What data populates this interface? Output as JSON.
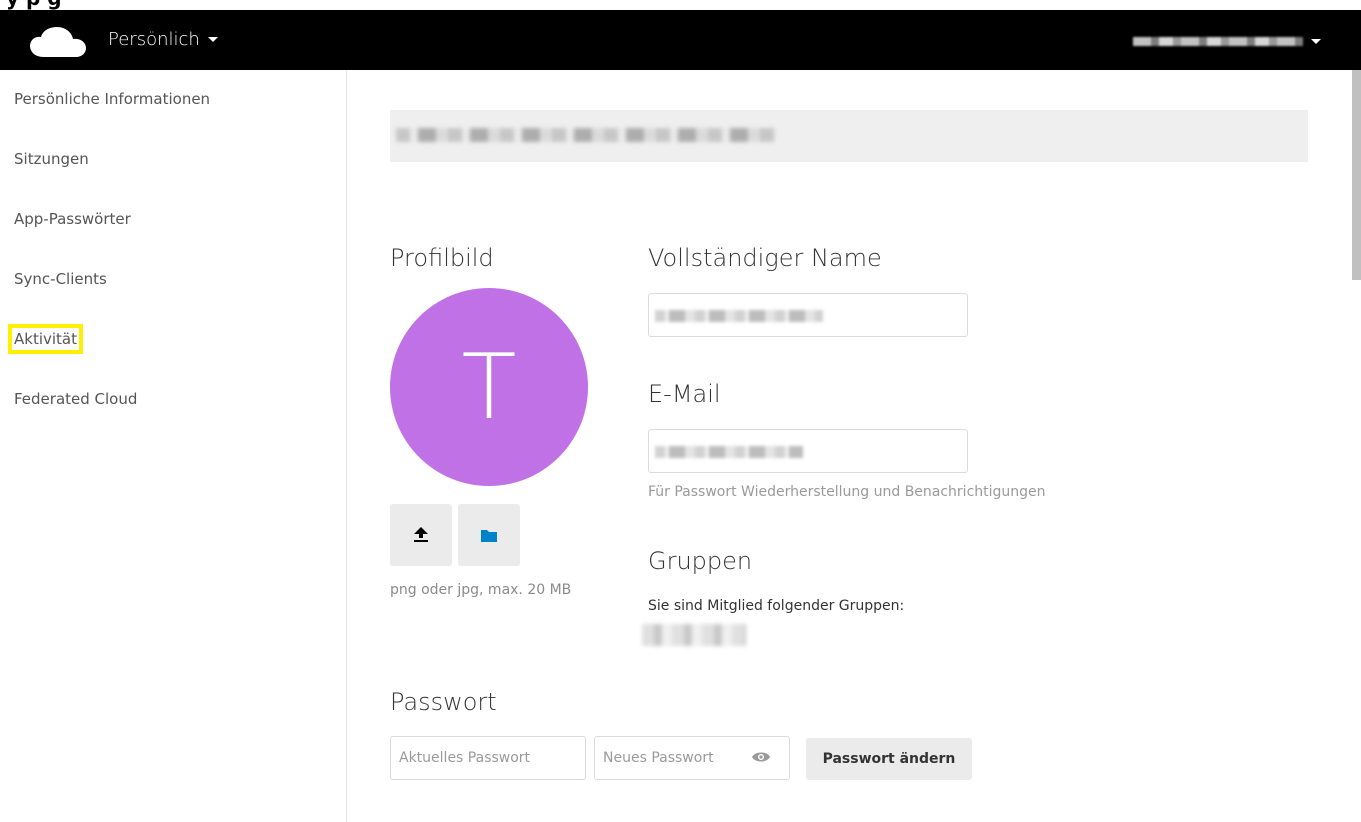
{
  "header": {
    "top_strip_text": "y        p                                          g",
    "app_menu_label": "Persönlich"
  },
  "sidebar": {
    "items": [
      {
        "label": "Persönliche Informationen"
      },
      {
        "label": "Sitzungen"
      },
      {
        "label": "App-Passwörter"
      },
      {
        "label": "Sync-Clients"
      },
      {
        "label": "Aktivität"
      },
      {
        "label": "Federated Cloud"
      }
    ]
  },
  "main": {
    "profile_picture_heading": "Profilbild",
    "avatar_letter": "T",
    "avatar_color": "#c071e6",
    "avatar_hint": "png oder jpg, max. 20 MB",
    "full_name_heading": "Vollständiger Name",
    "email_heading": "E-Mail",
    "email_hint": "Für Passwort Wiederherstellung und Benachrichtigungen",
    "groups_heading": "Gruppen",
    "groups_text": "Sie sind Mitglied folgender Gruppen:",
    "password_heading": "Passwort",
    "current_password_placeholder": "Aktuelles Passwort",
    "new_password_placeholder": "Neues Passwort",
    "change_password_button": "Passwort ändern",
    "upload_icon_color": "#000000",
    "folder_icon_color": "#0082c9"
  },
  "highlight_color": "#ffef00"
}
